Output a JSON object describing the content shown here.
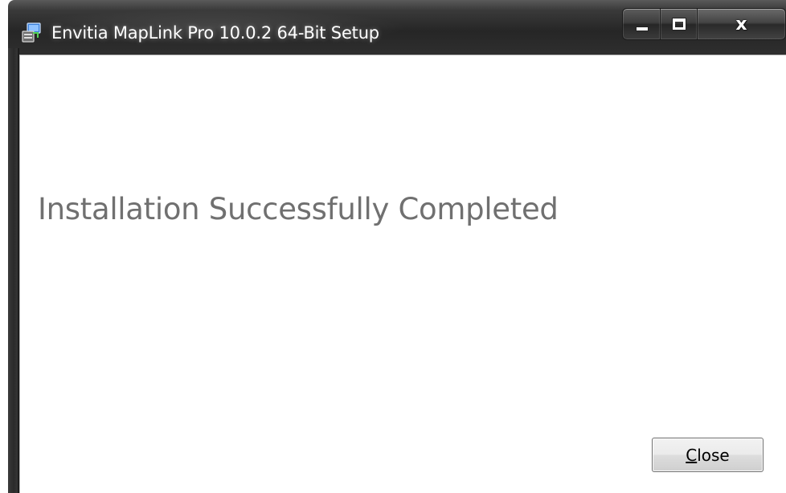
{
  "window": {
    "title": "Envitia MapLink Pro 10.0.2 64-Bit  Setup",
    "icon": "installer-icon",
    "caption_buttons": {
      "minimize_icon": "minimize-icon",
      "maximize_icon": "maximize-icon",
      "close_glyph": "x"
    }
  },
  "main": {
    "heading": "Installation Successfully Completed"
  },
  "footer": {
    "close_button": {
      "accesskey": "C",
      "rest": "lose"
    }
  },
  "colors": {
    "frame": "#262626",
    "heading_text": "#707070",
    "client_bg": "#ffffff"
  }
}
